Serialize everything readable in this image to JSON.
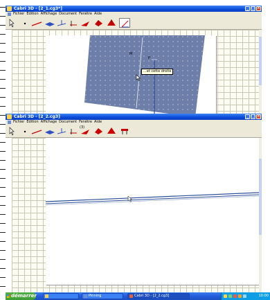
{
  "windows": [
    {
      "title": "Cabri 3D - [2_1.cg3*]",
      "menus": [
        "Fichier",
        "Edition",
        "Affichage",
        "Document",
        "Fenêtre",
        "Aide"
      ],
      "tooltip": "...et cette droite",
      "point_labels": [
        "M",
        "P"
      ]
    },
    {
      "title": "Cabri 3D - [2_2.cg3]",
      "menus": [
        "Fichier",
        "Edition",
        "Affichage",
        "Document",
        "Fenêtre",
        "Aide"
      ],
      "tool_badge": "(3)"
    }
  ],
  "taskbar": {
    "start_label": "démarrer",
    "tasks": [
      {
        "label": "",
        "icon": "folder-icon"
      },
      {
        "label": "Pinning",
        "icon": "document-icon"
      },
      {
        "label": "Cabri 3D - [2_2.cg3]",
        "icon": "cabri-icon"
      }
    ],
    "clock": "10:00"
  },
  "colors": {
    "title_blue": "#0a4ad7",
    "plane_blue": "#6d7fa8",
    "line_blue": "#2a4d9a",
    "start_green": "#3c9b32"
  }
}
